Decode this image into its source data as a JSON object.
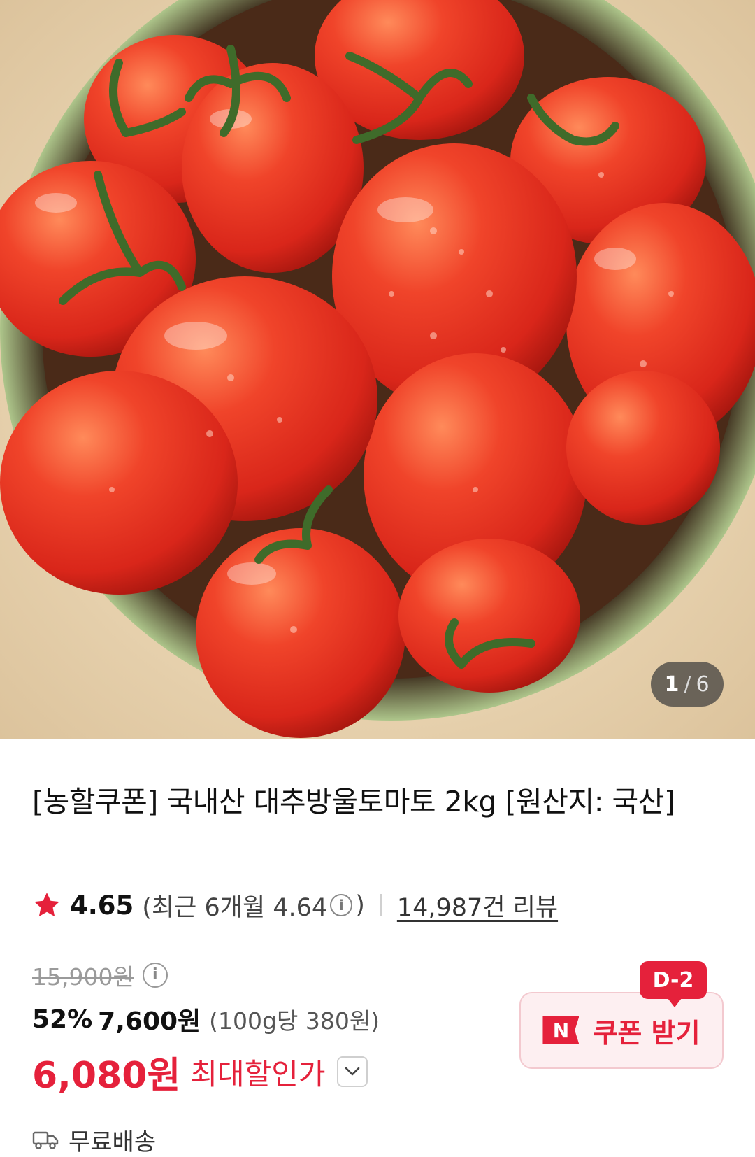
{
  "gallery": {
    "current": "1",
    "separator": "/",
    "total": "6"
  },
  "product": {
    "title": "[농할쿠폰] 국내산 대추방울토마토 2kg [원산지: 국산]",
    "rating": "4.65",
    "recent_rating_prefix": "(최근 6개월 4.64",
    "recent_rating_suffix": ")",
    "reviews": "14,987건 리뷰",
    "original_price": "15,900원",
    "discount_rate": "52%",
    "sale_price": "7,600원",
    "unit_price": "(100g당 380원)",
    "max_price": "6,080원",
    "max_label": "최대할인가",
    "shipping": "무료배송"
  },
  "coupon": {
    "badge": "D-2",
    "logo": "N",
    "label": "쿠폰 받기"
  },
  "icons": {
    "star": "star-icon",
    "info": "info-icon",
    "chevron": "chevron-down-icon",
    "truck": "truck-icon"
  },
  "colors": {
    "accent": "#e5213b",
    "star": "#e5213b",
    "coupon_bg": "#fdeff1"
  }
}
